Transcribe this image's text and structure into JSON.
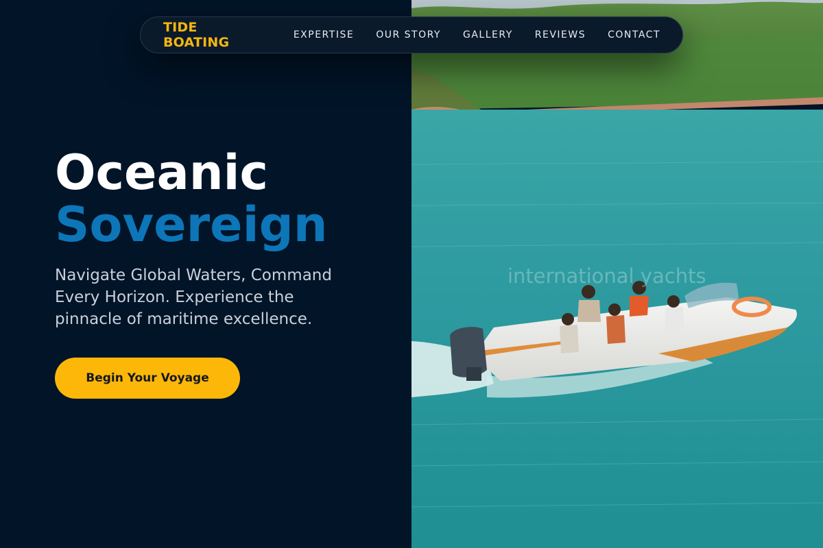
{
  "brand": "TIDE BOATING",
  "nav": [
    {
      "label": "EXPERTISE"
    },
    {
      "label": "OUR STORY"
    },
    {
      "label": "GALLERY"
    },
    {
      "label": "REVIEWS"
    },
    {
      "label": "CONTACT"
    }
  ],
  "hero": {
    "title_line1": "Oceanic",
    "title_line2": "Sovereign",
    "subtitle": "Navigate Global Waters, Command Every Horizon. Experience the pinnacle of maritime excellence.",
    "cta_label": "Begin Your Voyage"
  },
  "photo": {
    "watermark": "international yachts",
    "alt": "speedboat-on-lake"
  },
  "colors": {
    "background": "#021428",
    "accent": "#fcb709",
    "title_blue": "#0d76b8",
    "water": "#2e9ba0"
  }
}
